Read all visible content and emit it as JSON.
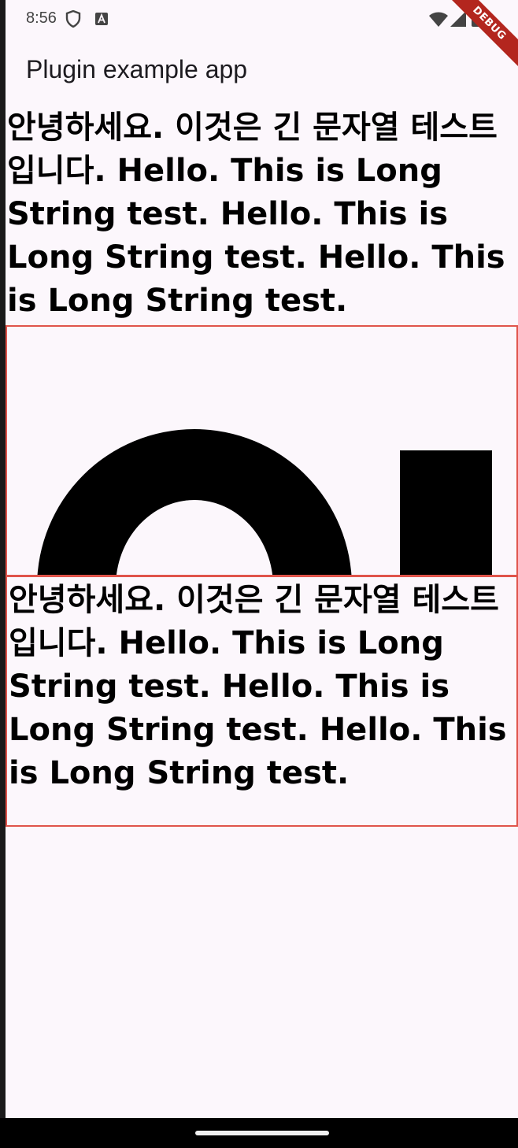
{
  "status_bar": {
    "time": "8:56",
    "icons": [
      "shield-icon",
      "text-a-icon",
      "wifi-icon",
      "cellular-signal-icon",
      "battery-icon"
    ],
    "debug_label": "DEBUG"
  },
  "app_bar": {
    "title": "Plugin example app"
  },
  "content": {
    "long_text_top": "안녕하세요. 이것은 긴 문자열 테스트입니다. Hello. This is Long String test. Hello. This is Long String test. Hello. This is Long String test.",
    "long_text_boxed": "안녕하세요. 이것은 긴 문자열 테스트입니다. Hello. This is Long String test. Hello. This is Long String test. Hello. This is Long String test."
  },
  "colors": {
    "background": "#fcf7fc",
    "border": "#e0544b",
    "text": "#000000",
    "debug_banner": "#b3261e"
  }
}
